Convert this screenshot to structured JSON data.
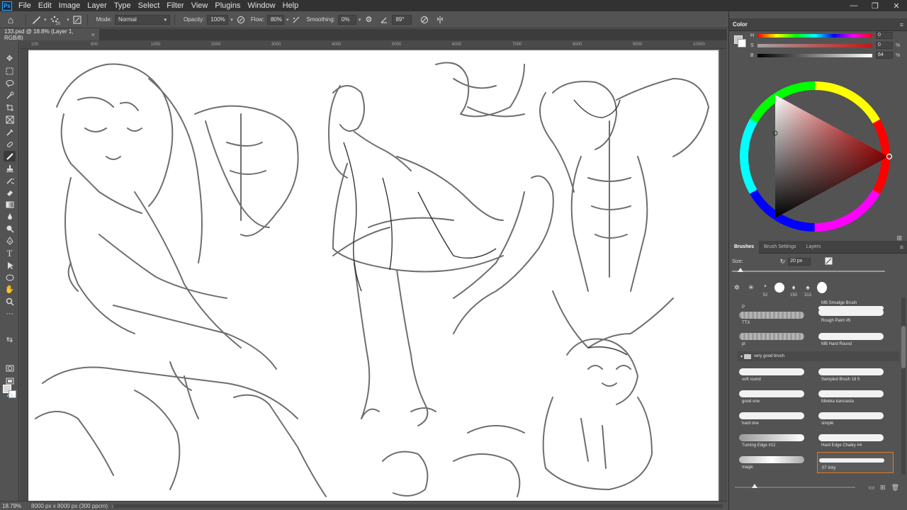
{
  "menubar": {
    "logo": "Ps",
    "items": [
      "File",
      "Edit",
      "Image",
      "Layer",
      "Type",
      "Select",
      "Filter",
      "View",
      "Plugins",
      "Window",
      "Help"
    ],
    "window_controls": [
      "—",
      "❐",
      "✕"
    ]
  },
  "options_bar": {
    "brush_size": "20",
    "mode_label": "Mode:",
    "mode_value": "Normal",
    "opacity_label": "Opacity:",
    "opacity_value": "100%",
    "flow_label": "Flow:",
    "flow_value": "80%",
    "smoothing_label": "Smoothing:",
    "smoothing_value": "0%",
    "angle_value": "89°"
  },
  "document_tab": {
    "title": "133.psd @ 18.8% (Layer 1, RGB/8)",
    "close": "×"
  },
  "status_bar": {
    "zoom": "18.79%",
    "doc_info": "8000 px x 8000 px (300 ppcm)",
    "caret": "›"
  },
  "color_panel": {
    "title": "Color",
    "sliders": [
      {
        "letter": "H",
        "value": "0",
        "unit": ""
      },
      {
        "letter": "S",
        "value": "0",
        "unit": "%"
      },
      {
        "letter": "B",
        "value": "64",
        "unit": "%"
      }
    ],
    "colors": {
      "foreground": "#c7c7c7",
      "background": "#ffffff"
    }
  },
  "brushes_panel": {
    "tabs": [
      "Brushes",
      "Brush Settings",
      "Layers"
    ],
    "size_label": "Size:",
    "size_value": "20 px",
    "preset_numbers": [
      "52",
      "150",
      "313"
    ],
    "brushes": [
      {
        "name": "P",
        "style": "none"
      },
      {
        "name": "MB Smudge Brush",
        "style": "white"
      },
      {
        "name": "TTX",
        "style": "grey"
      },
      {
        "name": "Rough Paint #5",
        "style": "white"
      },
      {
        "name": "pl",
        "style": "grey"
      },
      {
        "name": "MB Hard Round",
        "style": "white"
      }
    ],
    "group_name": "very good brush",
    "group_brushes": [
      {
        "name": "soft round"
      },
      {
        "name": "Sampled Brush 19 5"
      },
      {
        "name": "good one"
      },
      {
        "name": "Miekka kanciasta"
      },
      {
        "name": "hard one"
      },
      {
        "name": "simple"
      },
      {
        "name": "Turning Edge #12"
      },
      {
        "name": "Hard Edge Chalky #4"
      },
      {
        "name": "magic"
      },
      {
        "name": "07 Inky"
      }
    ],
    "selected_brush": "07 Inky"
  },
  "ruler_ticks": [
    "100",
    "800",
    "1000",
    "2000",
    "3000",
    "4000",
    "5000",
    "6000",
    "7000",
    "8000",
    "9000",
    "10000"
  ]
}
